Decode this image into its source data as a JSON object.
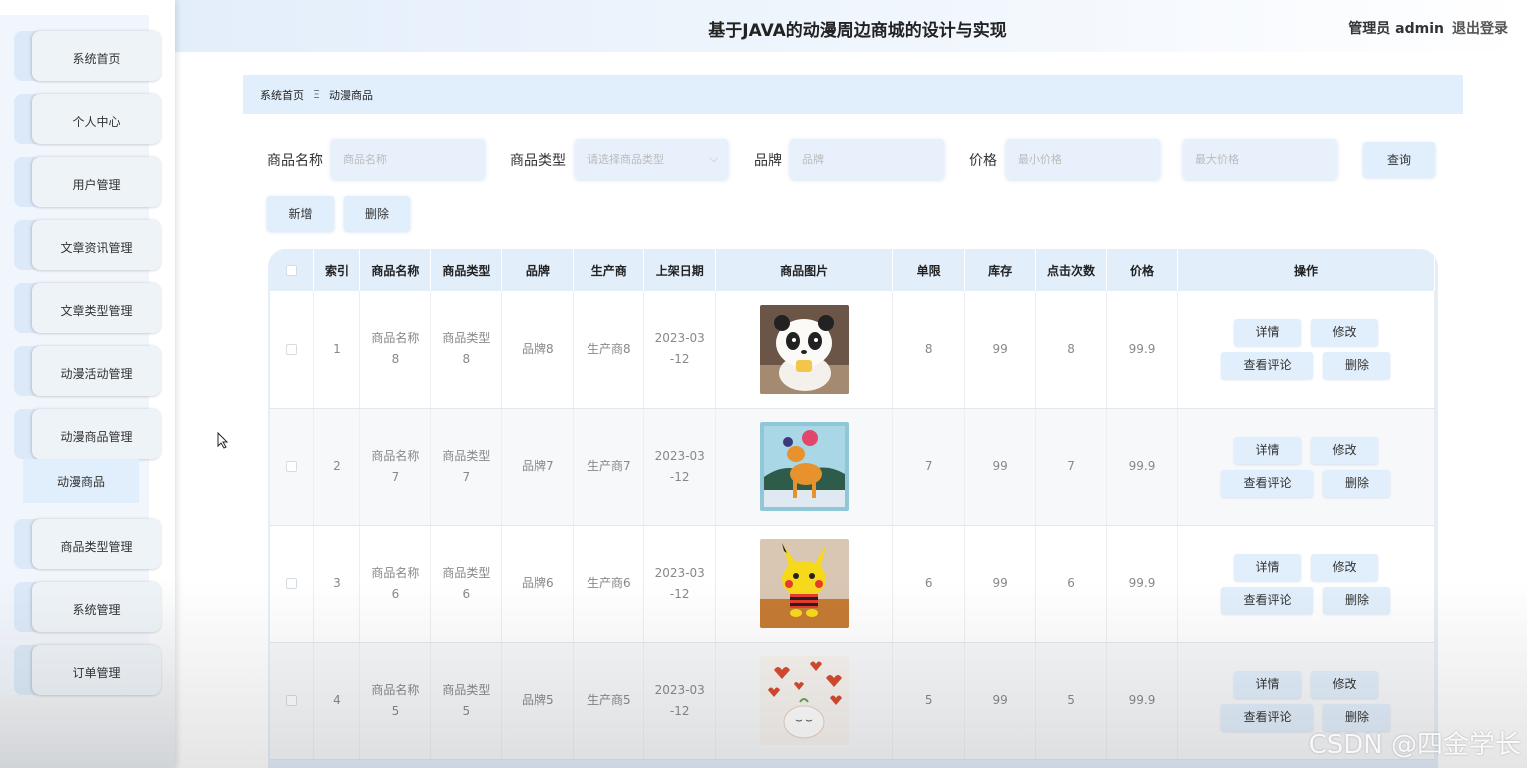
{
  "header": {
    "title": "基于JAVA的动漫周边商城的设计与实现",
    "user_label": "管理员 admin",
    "logout": "退出登录"
  },
  "sidebar": {
    "items": [
      {
        "label": "系统首页"
      },
      {
        "label": "个人中心"
      },
      {
        "label": "用户管理"
      },
      {
        "label": "文章资讯管理"
      },
      {
        "label": "文章类型管理"
      },
      {
        "label": "动漫活动管理"
      },
      {
        "label": "动漫商品管理"
      },
      {
        "label": "商品类型管理"
      },
      {
        "label": "系统管理"
      },
      {
        "label": "订单管理"
      }
    ],
    "sub_item": "动漫商品"
  },
  "breadcrumb": {
    "home": "系统首页",
    "separator": "Ξ",
    "current": "动漫商品"
  },
  "search": {
    "name_label": "商品名称",
    "name_placeholder": "商品名称",
    "type_label": "商品类型",
    "type_placeholder": "请选择商品类型",
    "brand_label": "品牌",
    "brand_placeholder": "品牌",
    "price_label": "价格",
    "min_price_placeholder": "最小价格",
    "max_price_placeholder": "最大价格",
    "query_button": "查询"
  },
  "actions": {
    "add": "新增",
    "delete": "删除"
  },
  "table": {
    "headers": [
      "索引",
      "商品名称",
      "商品类型",
      "品牌",
      "生产商",
      "上架日期",
      "商品图片",
      "单限",
      "库存",
      "点击次数",
      "价格",
      "操作"
    ],
    "rows": [
      {
        "index": "1",
        "name_a": "商品名称",
        "name_b": "8",
        "type_a": "商品类型",
        "type_b": "8",
        "brand": "品牌8",
        "maker": "生产商8",
        "date_a": "2023-03",
        "date_b": "-12",
        "limit": "8",
        "stock": "99",
        "clicks": "8",
        "price": "99.9",
        "image": "panda-plush"
      },
      {
        "index": "2",
        "name_a": "商品名称",
        "name_b": "7",
        "type_a": "商品类型",
        "type_b": "7",
        "brand": "品牌7",
        "maker": "生产商7",
        "date_a": "2023-03",
        "date_b": "-12",
        "limit": "7",
        "stock": "99",
        "clicks": "7",
        "price": "99.9",
        "image": "fawn-painting"
      },
      {
        "index": "3",
        "name_a": "商品名称",
        "name_b": "6",
        "type_a": "商品类型",
        "type_b": "6",
        "brand": "品牌6",
        "maker": "生产商6",
        "date_a": "2023-03",
        "date_b": "-12",
        "limit": "6",
        "stock": "99",
        "clicks": "6",
        "price": "99.9",
        "image": "pikachu-plush"
      },
      {
        "index": "4",
        "name_a": "商品名称",
        "name_b": "5",
        "type_a": "商品类型",
        "type_b": "5",
        "brand": "品牌5",
        "maker": "生产商5",
        "date_a": "2023-03",
        "date_b": "-12",
        "limit": "5",
        "stock": "99",
        "clicks": "5",
        "price": "99.9",
        "image": "hearts-doodle"
      }
    ],
    "ops": {
      "detail": "详情",
      "edit": "修改",
      "comments": "查看评论",
      "delete": "删除"
    }
  },
  "watermark": "CSDN @四金学长"
}
